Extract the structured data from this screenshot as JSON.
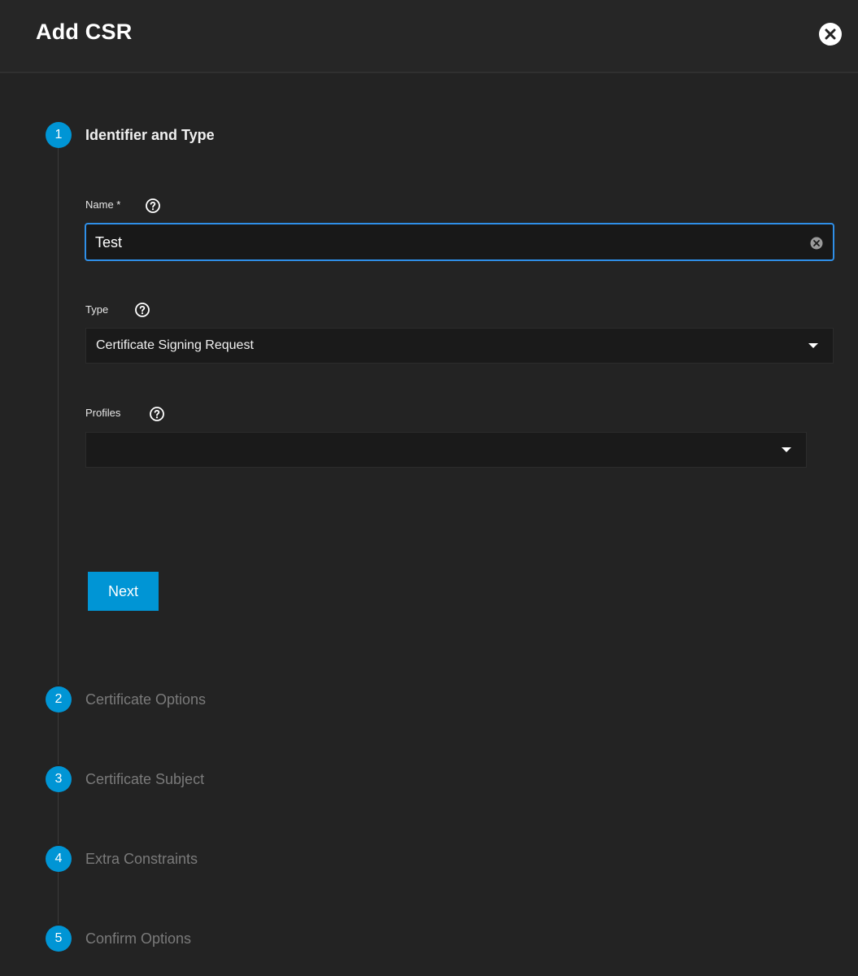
{
  "dialog": {
    "title": "Add CSR",
    "close_icon": "close-circle-icon"
  },
  "steps": [
    {
      "number": "1",
      "label": "Identifier and Type",
      "state": "active"
    },
    {
      "number": "2",
      "label": "Certificate Options",
      "state": "inactive"
    },
    {
      "number": "3",
      "label": "Certificate Subject",
      "state": "inactive"
    },
    {
      "number": "4",
      "label": "Extra Constraints",
      "state": "inactive"
    },
    {
      "number": "5",
      "label": "Confirm Options",
      "state": "inactive"
    }
  ],
  "form": {
    "name": {
      "label": "Name *",
      "value": "Test",
      "help_icon": "help-circle-icon",
      "clear_icon": "clear-icon"
    },
    "type": {
      "label": "Type",
      "value": "Certificate Signing Request",
      "help_icon": "help-circle-icon"
    },
    "profiles": {
      "label": "Profiles",
      "value": "",
      "help_icon": "help-circle-icon"
    },
    "next_label": "Next"
  },
  "colors": {
    "accent": "#0095d5",
    "focus_border": "#2f8fe8",
    "background": "#232323"
  }
}
